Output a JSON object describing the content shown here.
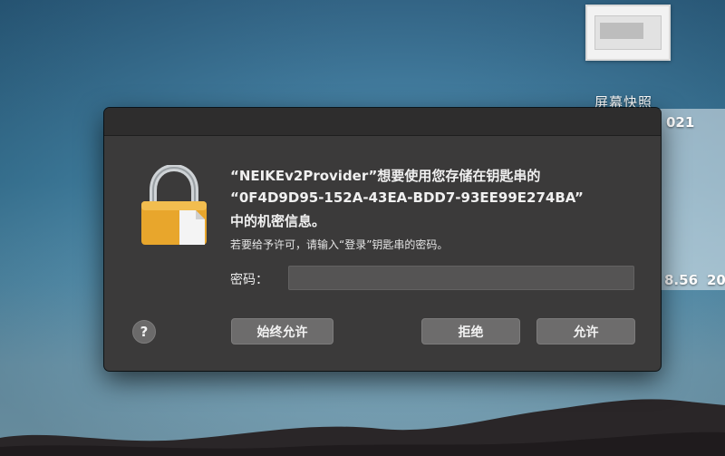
{
  "desktop": {
    "screenshot_label": "屏幕快照",
    "bg_fragment_1": "021",
    "bg_fragment_2": "8.56",
    "bg_fragment_3": "20",
    "bg_fragment_4": "20"
  },
  "dialog": {
    "message_line1": "“NEIKEv2Provider”想要使用您存储在钥匙串的",
    "message_line2": "“0F4D9D95-152A-43EA-BDD7-93EE99E274BA”",
    "message_line3": "中的机密信息。",
    "instruction": "若要给予许可，请输入“登录”钥匙串的密码。",
    "password_label": "密码：",
    "password_value": "",
    "help_label": "?",
    "always_allow_label": "始终允许",
    "deny_label": "拒绝",
    "allow_label": "允许"
  },
  "colors": {
    "dialog_bg": "#3b3a3a",
    "button_bg": "#6d6c6c",
    "lock_body": "#e8a62c",
    "lock_shackle": "#cfd3d6"
  }
}
